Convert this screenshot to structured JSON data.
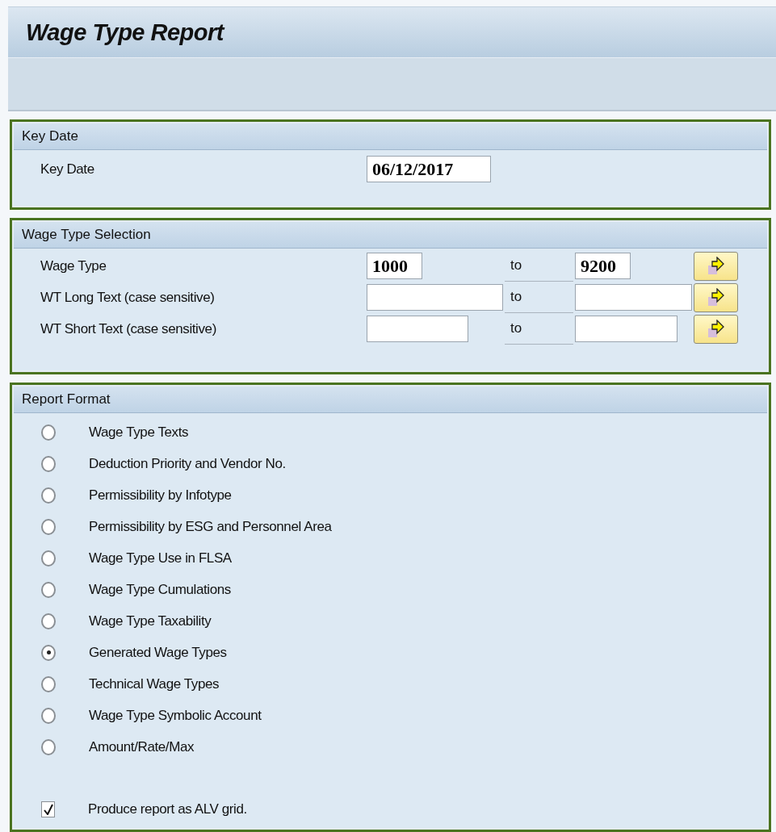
{
  "window": {
    "title": "Wage Type Report"
  },
  "key_date": {
    "title": "Key Date",
    "label": "Key Date",
    "value": "06/12/2017"
  },
  "selection": {
    "title": "Wage Type Selection",
    "rows": [
      {
        "label": "Wage Type",
        "low": "1000",
        "to": "to",
        "high": "9200"
      },
      {
        "label": "WT Long Text (case sensitive)",
        "to": "to"
      },
      {
        "label": "WT Short Text (case sensitive)",
        "to": "to"
      }
    ]
  },
  "report_format": {
    "title": "Report Format",
    "options": [
      {
        "label": "Wage Type Texts",
        "selected": false
      },
      {
        "label": "Deduction Priority and Vendor No.",
        "selected": false
      },
      {
        "label": "Permissibility by Infotype",
        "selected": false
      },
      {
        "label": "Permissibility by ESG and Personnel Area",
        "selected": false
      },
      {
        "label": "Wage Type Use in FLSA",
        "selected": false
      },
      {
        "label": "Wage Type Cumulations",
        "selected": false
      },
      {
        "label": "Wage Type Taxability",
        "selected": false
      },
      {
        "label": "Generated Wage Types",
        "selected": true
      },
      {
        "label": "Technical Wage Types",
        "selected": false
      },
      {
        "label": "Wage Type Symbolic Account",
        "selected": false
      },
      {
        "label": "Amount/Rate/Max",
        "selected": false
      }
    ],
    "alv": {
      "label": "Produce report as ALV grid.",
      "checked": true
    }
  }
}
